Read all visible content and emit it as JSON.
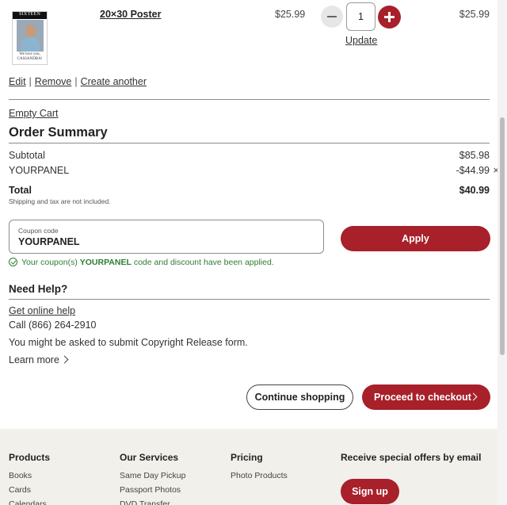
{
  "item": {
    "thumbnail": {
      "banner_text": "SIXTEEN",
      "caption_line1": "We love you,",
      "caption_line2": "CASSANDRA!"
    },
    "title": "20×30 Poster",
    "unit_price": "$25.99",
    "quantity": "1",
    "update_label": "Update",
    "line_total": "$25.99",
    "actions": {
      "edit": "Edit",
      "remove": "Remove",
      "create_another": "Create another",
      "separator": "|"
    }
  },
  "cart": {
    "empty_label": "Empty Cart"
  },
  "summary": {
    "title": "Order Summary",
    "subtotal_label": "Subtotal",
    "subtotal_value": "$85.98",
    "coupon_label": "YOURPANEL",
    "coupon_value": "-$44.99",
    "coupon_remove_glyph": "×",
    "total_label": "Total",
    "total_value": "$40.99",
    "tax_note": "Shipping and tax are not included."
  },
  "coupon": {
    "field_label": "Coupon code",
    "field_value": "YOURPANEL",
    "apply_label": "Apply",
    "msg_prefix": "Your coupon(s)",
    "msg_code": "YOURPANEL",
    "msg_suffix": "code and discount have been applied.",
    "status_color": "#2e7d32"
  },
  "help": {
    "title": "Need Help?",
    "online_help": "Get online help",
    "phone": "Call (866) 264-2910",
    "note": "You might be asked to submit Copyright Release form.",
    "learn_more": "Learn more"
  },
  "actions": {
    "continue_label": "Continue shopping",
    "checkout_label": "Proceed to checkout"
  },
  "footer": {
    "products": {
      "heading": "Products",
      "links": [
        "Books",
        "Cards",
        "Calendars"
      ]
    },
    "services": {
      "heading": "Our Services",
      "links": [
        "Same Day Pickup",
        "Passport Photos",
        "DVD Transfer"
      ]
    },
    "pricing": {
      "heading": "Pricing",
      "links": [
        "Photo Products"
      ]
    },
    "offers": {
      "heading": "Receive special offers by email",
      "signup_label": "Sign up"
    }
  },
  "colors": {
    "brand_red": "#a8202a",
    "footer_bg": "#f1f0eb"
  }
}
